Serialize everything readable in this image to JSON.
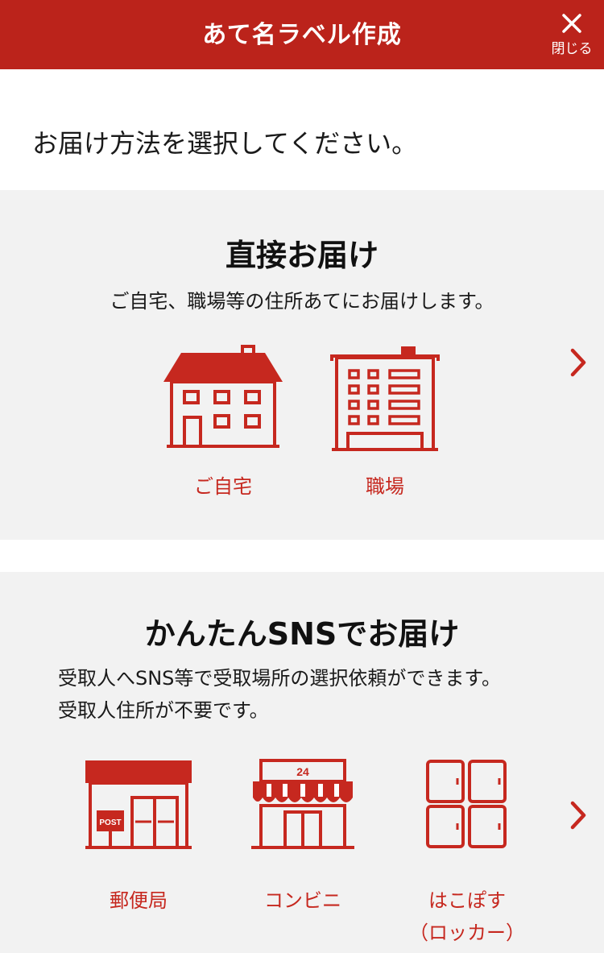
{
  "header": {
    "title": "あて名ラベル作成",
    "close_label": "閉じる"
  },
  "instruction": "お届け方法を選択してください。",
  "direct": {
    "title": "直接お届け",
    "description": "ご自宅、職場等の住所あてにお届けします。",
    "options": [
      {
        "label": "ご自宅",
        "icon": "house-icon"
      },
      {
        "label": "職場",
        "icon": "office-building-icon"
      }
    ]
  },
  "sns": {
    "title": "かんたんSNSでお届け",
    "description_lines": [
      "受取人へSNS等で受取場所の選択依頼ができます。",
      "受取人住所が不要です。"
    ],
    "options": [
      {
        "label": "郵便局",
        "icon": "post-office-icon",
        "sign_text": "POST"
      },
      {
        "label": "コンビニ",
        "icon": "convenience-store-icon",
        "sign_text": "24"
      },
      {
        "label_lines": [
          "はこぽす",
          "（ロッカー）"
        ],
        "icon": "locker-icon"
      }
    ]
  },
  "colors": {
    "brand_red": "#bb231b",
    "label_red": "#c6281f",
    "section_bg": "#f2f2f2"
  }
}
